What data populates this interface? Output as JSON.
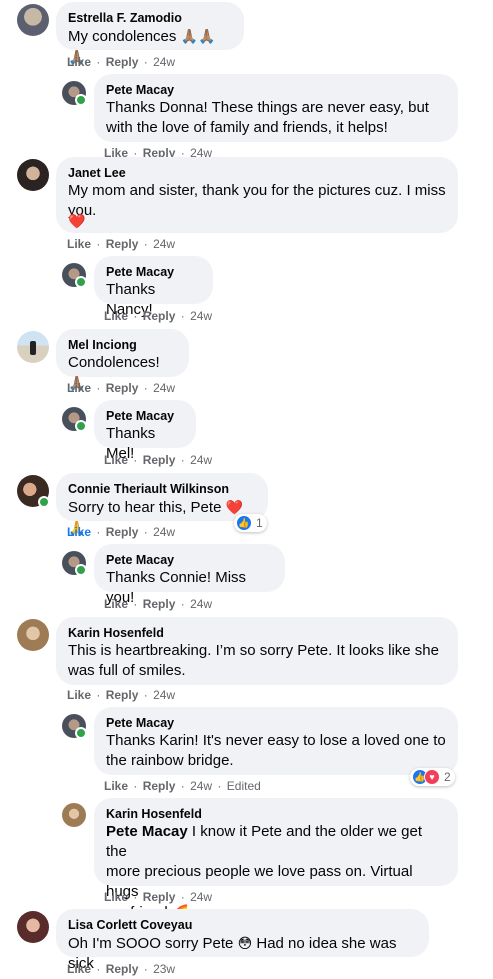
{
  "comments": [
    {
      "name": "Estrella F. Zamodio",
      "text": "My condolences",
      "emoji": "🙏🏽🙏🏽🙏🏽",
      "like": "Like",
      "reply": "Reply",
      "time": "24w"
    },
    {
      "name": "Pete Macay",
      "text1": "Thanks Donna! These things are never easy, but",
      "text2": "with the love of family and friends, it helps!",
      "like": "Like",
      "reply": "Reply",
      "time": "24w"
    },
    {
      "name": "Janet Lee",
      "text1": "My mom and sister, thank you for the pictures cuz. I miss",
      "text2": "you.",
      "emoji": "❤️",
      "like": "Like",
      "reply": "Reply",
      "time": "24w"
    },
    {
      "name": "Pete Macay",
      "text": "Thanks Nancy!",
      "like": "Like",
      "reply": "Reply",
      "time": "24w"
    },
    {
      "name": "Mel Inciong",
      "text": "Condolences!",
      "emoji": "🙏🏽",
      "like": "Like",
      "reply": "Reply",
      "time": "24w"
    },
    {
      "name": "Pete Macay",
      "text": "Thanks Mel!",
      "like": "Like",
      "reply": "Reply",
      "time": "24w"
    },
    {
      "name": "Connie Theriault Wilkinson",
      "text": "Sorry to hear this, Pete",
      "emoji": "❤️🙏",
      "like": "Like",
      "reply": "Reply",
      "time": "24w",
      "reaction_count": "1"
    },
    {
      "name": "Pete Macay",
      "text": "Thanks Connie! Miss you!",
      "like": "Like",
      "reply": "Reply",
      "time": "24w"
    },
    {
      "name": "Karin Hosenfeld",
      "text1": "This is heartbreaking. I’m so sorry Pete. It looks like she",
      "text2": "was full of smiles.",
      "like": "Like",
      "reply": "Reply",
      "time": "24w"
    },
    {
      "name": "Pete Macay",
      "text1": "Thanks Karin! It's never easy to lose a loved one to",
      "text2": "the rainbow bridge.",
      "like": "Like",
      "reply": "Reply",
      "time": "24w",
      "edited": "Edited",
      "reaction_count": "2"
    },
    {
      "name": "Karin Hosenfeld",
      "tag": "Pete Macay",
      "text1": " I know it Pete and the older we get the",
      "text2": "more precious people we love pass on. Virtual hugs",
      "text3": "my friend",
      "emoji": "🌈",
      "like": "Like",
      "reply": "Reply",
      "time": "24w"
    },
    {
      "name": "Lisa Corlett Coveyau",
      "text": "Oh I'm SOOO sorry Pete",
      "emoji": "😳",
      "text_after": "Had no idea she was sick",
      "like": "Like",
      "reply": "Reply",
      "time": "23w"
    }
  ],
  "dot": "·",
  "colors": {
    "bubble": "#f0f2f5",
    "meta": "#65676b",
    "link": "#1877f2",
    "online": "#31a24c"
  }
}
